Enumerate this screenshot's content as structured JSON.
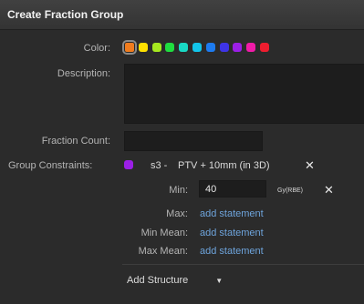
{
  "dialog": {
    "title": "Create Fraction Group"
  },
  "labels": {
    "color": "Color:",
    "description": "Description:",
    "fraction_count": "Fraction Count:",
    "group_constraints": "Group Constraints:",
    "min": "Min:",
    "max": "Max:",
    "min_mean": "Min Mean:",
    "max_mean": "Max Mean:"
  },
  "colors": [
    "#f07c1e",
    "#ffe100",
    "#a6e81f",
    "#1fdd3f",
    "#19d9c4",
    "#12c5ea",
    "#1d7bf0",
    "#3e34e6",
    "#9b1fe6",
    "#f01ba8",
    "#ee1d2f"
  ],
  "selected_color_index": 0,
  "description": {
    "value": ""
  },
  "fraction_count": {
    "value": ""
  },
  "constraint": {
    "color": "#9b1fe6",
    "structure": "s3 -",
    "name": "PTV + 10mm (in 3D)",
    "remove_icon": "close-icon",
    "min_value": "40",
    "min_unit": "Gy(RBE)",
    "max_link": "add statement",
    "min_mean_link": "add statement",
    "max_mean_link": "add statement"
  },
  "add_structure": {
    "label": "Add Structure",
    "arrow": "▼"
  }
}
